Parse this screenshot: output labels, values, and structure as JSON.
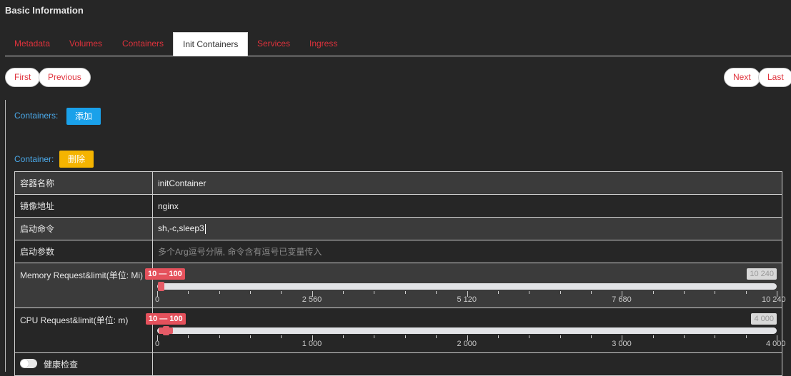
{
  "page_title": "Basic Information",
  "tabs": [
    {
      "label": "Metadata"
    },
    {
      "label": "Volumes"
    },
    {
      "label": "Containers"
    },
    {
      "label": "Init Containers"
    },
    {
      "label": "Services"
    },
    {
      "label": "Ingress"
    }
  ],
  "active_tab": "Init Containers",
  "pager": {
    "first": "First",
    "previous": "Previous",
    "next": "Next",
    "last": "Last"
  },
  "containers_label": "Containers:",
  "add_button": "添加",
  "container_label": "Container:",
  "delete_button": "删除",
  "form": {
    "name_label": "容器名称",
    "name_value": "initContainer",
    "image_label": "镜像地址",
    "image_value": "nginx",
    "command_label": "启动命令",
    "command_value": "sh,-c,sleep3",
    "args_label": "启动参数",
    "args_placeholder": "多个Arg逗号分隔, 命令含有逗号已变量传入",
    "memory_label": "Memory Request&limit(单位: Mi)",
    "cpu_label": "CPU Request&limit(单位: m)",
    "health_label": "健康检查"
  },
  "memory_slider": {
    "min": 0,
    "max": 10240,
    "from": 10,
    "to": 100,
    "range_text": "10 — 100",
    "max_text": "10 240",
    "tick_labels": [
      "0",
      "2 560",
      "5 120",
      "7 680",
      "10 240"
    ]
  },
  "cpu_slider": {
    "min": 0,
    "max": 4000,
    "from": 10,
    "to": 100,
    "range_text": "10 — 100",
    "max_text": "4 000",
    "tick_labels": [
      "0",
      "1 000",
      "2 000",
      "3 000",
      "4 000"
    ]
  },
  "colors": {
    "accent_red": "#e0323c",
    "add_blue": "#1aa1ea",
    "delete_yellow": "#f5b400",
    "slider_red": "#e55b67"
  }
}
